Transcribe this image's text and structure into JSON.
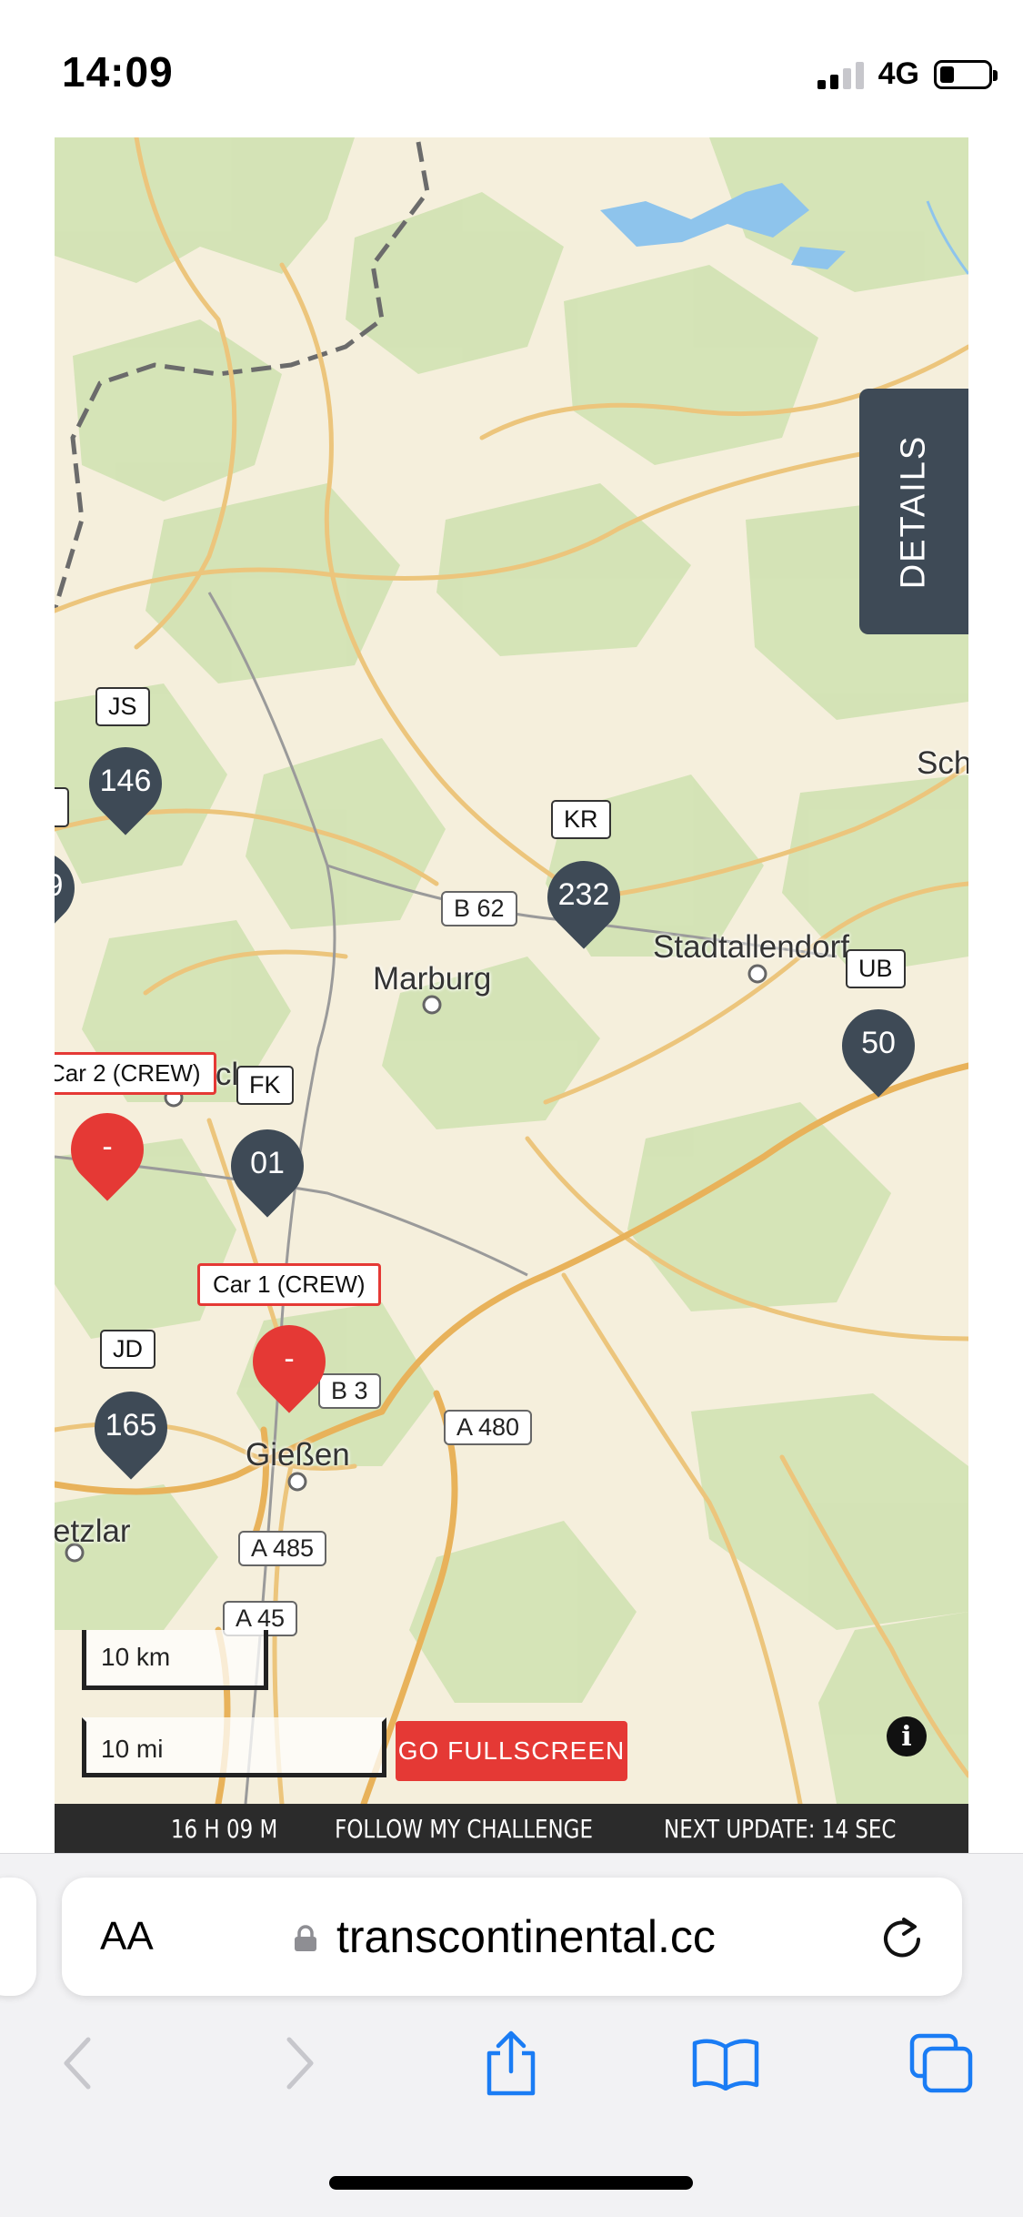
{
  "status_bar": {
    "time": "14:09",
    "network": "4G",
    "battery_fraction": 0.3,
    "signal_bars_filled": 2
  },
  "map": {
    "details_tab": "DETAILS",
    "roads": [
      "B 62",
      "B 3",
      "A 480",
      "A 485",
      "A 45"
    ],
    "places": [
      "Marburg",
      "Stadtallendorf",
      "Gießen",
      "etzlar",
      "Sch",
      "bacl"
    ],
    "riders": [
      {
        "tag": "JS",
        "number": "146"
      },
      {
        "tag": "KR",
        "number": "232"
      },
      {
        "tag": "UB",
        "number": "50"
      },
      {
        "tag": "FK",
        "number": "01"
      },
      {
        "tag": "JD",
        "number": "165"
      },
      {
        "tag": "",
        "number": "9"
      }
    ],
    "crew": [
      {
        "label": "Car 2 (CREW)",
        "pin": "-"
      },
      {
        "label": "Car 1 (CREW)",
        "pin": "-"
      }
    ],
    "scale_km": "10 km",
    "scale_mi": "10 mi",
    "fullscreen_button": "GO FULLSCREEN",
    "info_icon": "i",
    "colors": {
      "rider_pin": "#3e4a56",
      "crew_pin": "#e53935",
      "footer": "#2b2b2b"
    }
  },
  "footer": {
    "elapsed": "16 H 09 M",
    "follow": "FOLLOW MY CHALLENGE",
    "next_update": "NEXT UPDATE: 14 SEC"
  },
  "browser": {
    "aa_label": "AA",
    "url": "transcontinental.cc",
    "icons": [
      "back-icon",
      "forward-icon",
      "share-icon",
      "bookmarks-icon",
      "tabs-icon",
      "reload-icon",
      "lock-icon"
    ]
  }
}
